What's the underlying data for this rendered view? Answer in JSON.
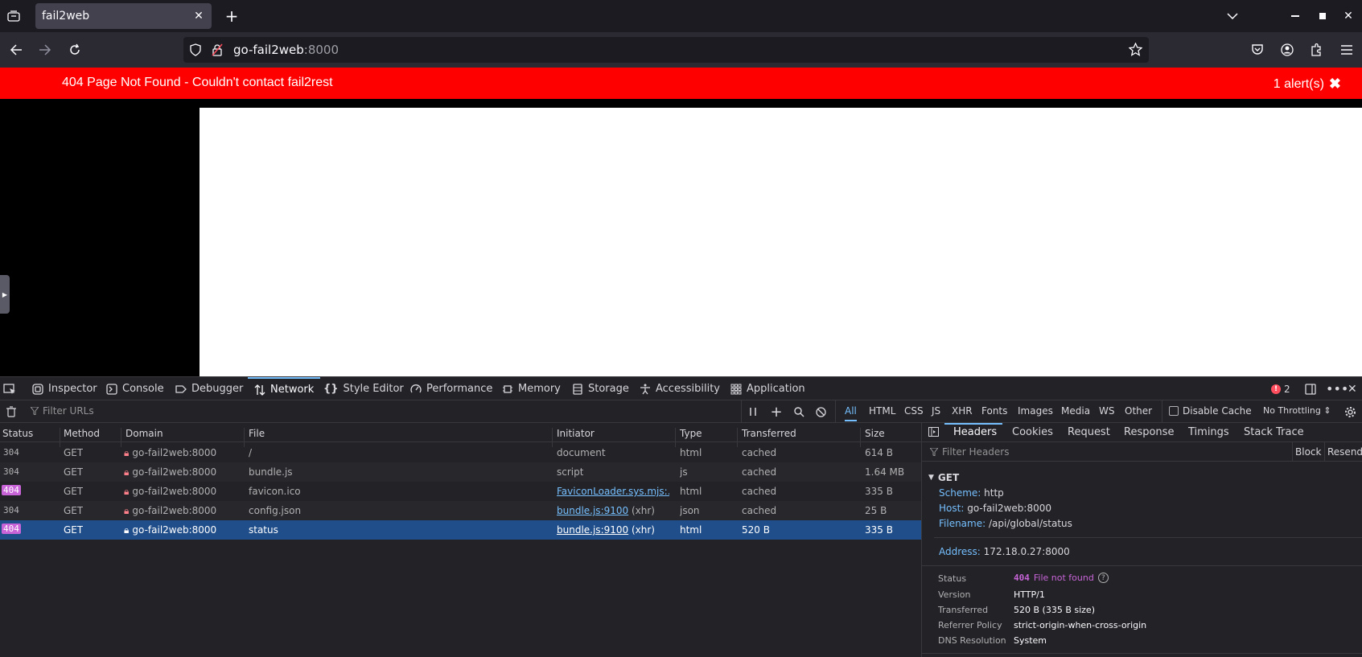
{
  "browser": {
    "tab_title": "fail2web",
    "url_host": "go-fail2web",
    "url_port": ":8000"
  },
  "alert": {
    "message": "404 Page Not Found - Couldn't contact fail2rest",
    "count_label": "1 alert(s)"
  },
  "devtools": {
    "tabs": [
      "Inspector",
      "Console",
      "Debugger",
      "Network",
      "Style Editor",
      "Performance",
      "Memory",
      "Storage",
      "Accessibility",
      "Application"
    ],
    "error_count": "2",
    "network": {
      "filter_placeholder": "Filter URLs",
      "type_filters": [
        "All",
        "HTML",
        "CSS",
        "JS",
        "XHR",
        "Fonts",
        "Images",
        "Media",
        "WS",
        "Other"
      ],
      "disable_cache_label": "Disable Cache",
      "throttling_label": "No Throttling",
      "columns": [
        "Status",
        "Method",
        "Domain",
        "File",
        "Initiator",
        "Type",
        "Transferred",
        "Size"
      ],
      "rows": [
        {
          "status": "304",
          "method": "GET",
          "domain": "go-fail2web:8000",
          "file": "/",
          "initiator": "document",
          "initiator_suffix": "",
          "type": "html",
          "transferred": "cached",
          "size": "614 B"
        },
        {
          "status": "304",
          "method": "GET",
          "domain": "go-fail2web:8000",
          "file": "bundle.js",
          "initiator": "script",
          "initiator_suffix": "",
          "type": "js",
          "transferred": "cached",
          "size": "1.64 MB"
        },
        {
          "status": "404",
          "method": "GET",
          "domain": "go-fail2web:8000",
          "file": "favicon.ico",
          "initiator": "FaviconLoader.sys.mjs:...",
          "initiator_suffix": "",
          "type": "html",
          "transferred": "cached",
          "size": "335 B"
        },
        {
          "status": "304",
          "method": "GET",
          "domain": "go-fail2web:8000",
          "file": "config.json",
          "initiator": "bundle.js:9100",
          "initiator_suffix": " (xhr)",
          "type": "json",
          "transferred": "cached",
          "size": "25 B"
        },
        {
          "status": "404",
          "method": "GET",
          "domain": "go-fail2web:8000",
          "file": "status",
          "initiator": "bundle.js:9100",
          "initiator_suffix": " (xhr)",
          "type": "html",
          "transferred": "520 B",
          "size": "335 B"
        }
      ]
    },
    "sidepanel": {
      "tabs": [
        "Headers",
        "Cookies",
        "Request",
        "Response",
        "Timings",
        "Stack Trace"
      ],
      "filter_placeholder": "Filter Headers",
      "block_label": "Block",
      "resend_label": "Resend",
      "method": "GET",
      "scheme_key": "Scheme:",
      "scheme_val": "http",
      "host_key": "Host:",
      "host_val": "go-fail2web:8000",
      "filename_key": "Filename:",
      "filename_val": "/api/global/status",
      "address_key": "Address:",
      "address_val": "172.18.0.27:8000",
      "status_key": "Status",
      "status_code": "404",
      "status_text": "File not found",
      "version_key": "Version",
      "version_val": "HTTP/1",
      "transferred_key": "Transferred",
      "transferred_val": "520 B (335 B size)",
      "referrer_key": "Referrer Policy",
      "referrer_val": "strict-origin-when-cross-origin",
      "dns_key": "DNS Resolution",
      "dns_val": "System"
    }
  }
}
